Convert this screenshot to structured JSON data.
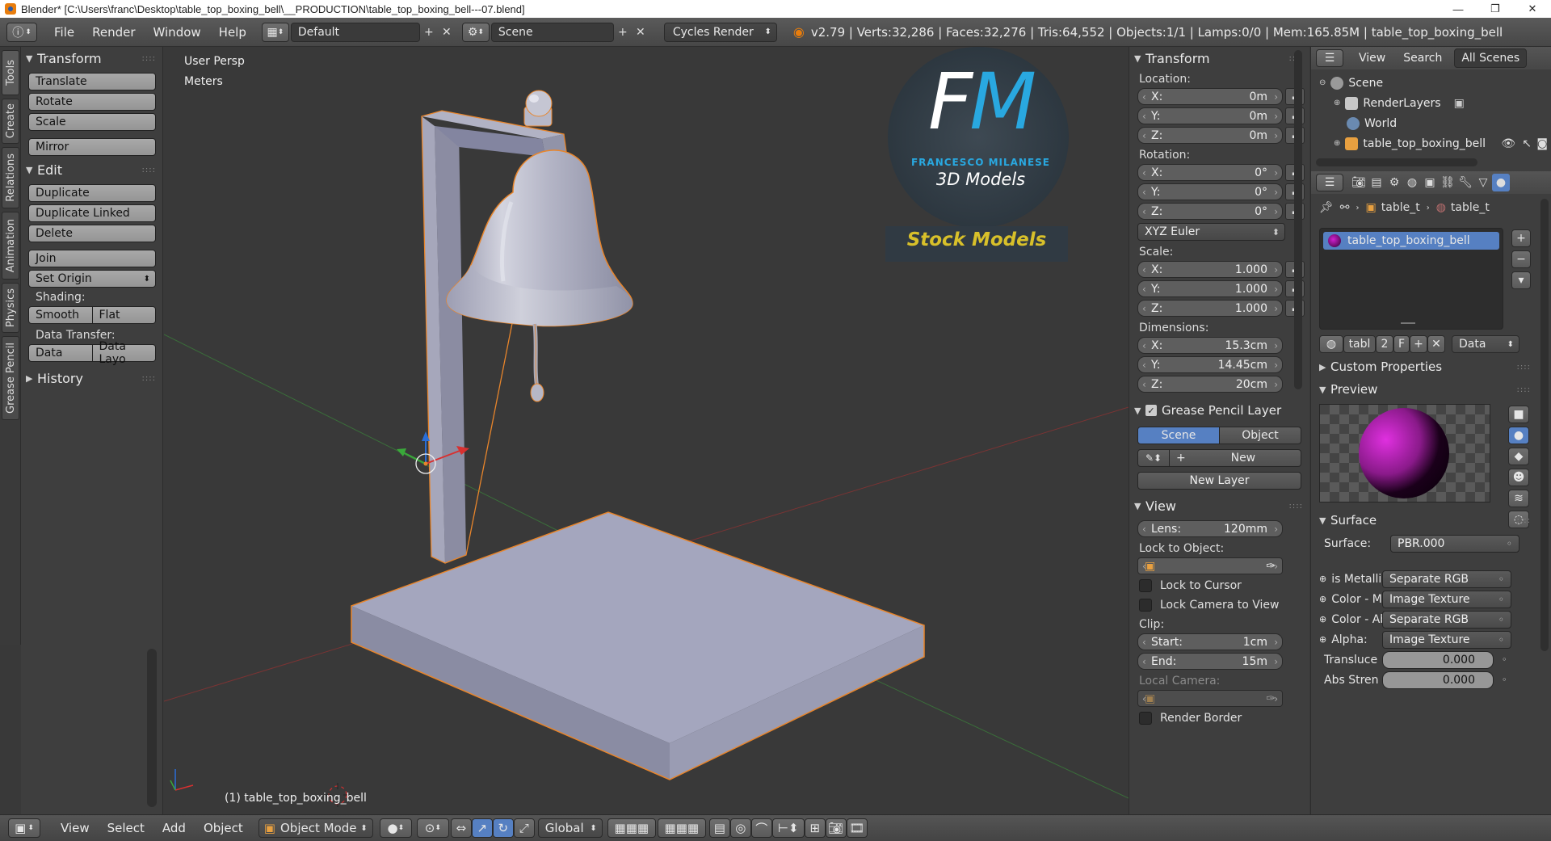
{
  "window": {
    "title": "Blender* [C:\\Users\\franc\\Desktop\\table_top_boxing_bell\\__PRODUCTION\\table_top_boxing_bell---07.blend]",
    "controls": [
      "—",
      "❐",
      "✕"
    ]
  },
  "header": {
    "menus": [
      "File",
      "Render",
      "Window",
      "Help"
    ],
    "layout": "Default",
    "scene": "Scene",
    "engine": "Cycles Render",
    "stats": "v2.79 | Verts:32,286 | Faces:32,276 | Tris:64,552 | Objects:1/1 | Lamps:0/0 | Mem:165.85M | table_top_boxing_bell"
  },
  "tabstrip": [
    "Tools",
    "Create",
    "Relations",
    "Animation",
    "Physics",
    "Grease Pencil"
  ],
  "toolshelf": {
    "transform": {
      "title": "Transform",
      "buttons": [
        "Translate",
        "Rotate",
        "Scale"
      ],
      "mirror": "Mirror"
    },
    "edit": {
      "title": "Edit",
      "buttons": [
        "Duplicate",
        "Duplicate Linked",
        "Delete"
      ],
      "join": "Join",
      "set_origin": "Set Origin",
      "shading_label": "Shading:",
      "shading": [
        "Smooth",
        "Flat"
      ],
      "data_transfer_label": "Data Transfer:",
      "data_transfer": [
        "Data",
        "Data Layo"
      ]
    },
    "history": "History"
  },
  "viewport": {
    "view_name": "User Persp",
    "units": "Meters",
    "object_label": "(1) table_top_boxing_bell",
    "watermark": {
      "initials": "FM",
      "name": "FRANCESCO MILANESE",
      "subtitle": "3D Models",
      "tag": "Stock Models"
    }
  },
  "npanel": {
    "transform_title": "Transform",
    "location_label": "Location:",
    "location": [
      {
        "axis": "X:",
        "value": "0m"
      },
      {
        "axis": "Y:",
        "value": "0m"
      },
      {
        "axis": "Z:",
        "value": "0m"
      }
    ],
    "rotation_label": "Rotation:",
    "rotation": [
      {
        "axis": "X:",
        "value": "0°"
      },
      {
        "axis": "Y:",
        "value": "0°"
      },
      {
        "axis": "Z:",
        "value": "0°"
      }
    ],
    "rotation_mode": "XYZ Euler",
    "scale_label": "Scale:",
    "scale": [
      {
        "axis": "X:",
        "value": "1.000"
      },
      {
        "axis": "Y:",
        "value": "1.000"
      },
      {
        "axis": "Z:",
        "value": "1.000"
      }
    ],
    "dimensions_label": "Dimensions:",
    "dimensions": [
      {
        "axis": "X:",
        "value": "15.3cm"
      },
      {
        "axis": "Y:",
        "value": "14.45cm"
      },
      {
        "axis": "Z:",
        "value": "20cm"
      }
    ],
    "grease_pencil_title": "Grease Pencil Layer",
    "gp_tabs": [
      "Scene",
      "Object"
    ],
    "gp_new": "New",
    "gp_new_layer": "New Layer",
    "view_title": "View",
    "lens_label": "Lens:",
    "lens": "120mm",
    "lock_to_object_label": "Lock to Object:",
    "lock_to_cursor": "Lock to Cursor",
    "lock_camera": "Lock Camera to View",
    "clip_label": "Clip:",
    "clip_start_label": "Start:",
    "clip_start": "1cm",
    "clip_end_label": "End:",
    "clip_end": "15m",
    "local_camera_label": "Local Camera:",
    "render_border": "Render Border"
  },
  "outliner": {
    "menus": [
      "View",
      "Search"
    ],
    "scope": "All Scenes",
    "items": [
      "Scene",
      "RenderLayers",
      "World",
      "table_top_boxing_bell"
    ]
  },
  "properties": {
    "breadcrumb": [
      "table_t",
      "table_t"
    ],
    "material_slot": "table_top_boxing_bell",
    "material_name": "tabl",
    "users": "2",
    "fake_user": "F",
    "link": "Data",
    "custom_properties": "Custom Properties",
    "preview": "Preview",
    "surface_title": "Surface",
    "surface_label": "Surface:",
    "surface_value": "PBR.000",
    "inputs": [
      {
        "label": "is Metallic",
        "value": "Separate RGB"
      },
      {
        "label": "Color - Ma",
        "value": "Image Texture"
      },
      {
        "label": "Color - Ab",
        "value": "Separate RGB"
      },
      {
        "label": "Alpha:",
        "value": "Image Texture"
      }
    ],
    "sliders": [
      {
        "label": "Transluce",
        "value": "0.000"
      },
      {
        "label": "Abs Stren",
        "value": "0.000"
      }
    ]
  },
  "bottombar": {
    "menus": [
      "View",
      "Select",
      "Add",
      "Object"
    ],
    "mode": "Object Mode",
    "orientation": "Global"
  },
  "colors": {
    "selection_outline": "#e8852b",
    "active_blue": "#5680c2",
    "watermark_blue": "#29a8e0",
    "watermark_yellow": "#d8c02a"
  }
}
